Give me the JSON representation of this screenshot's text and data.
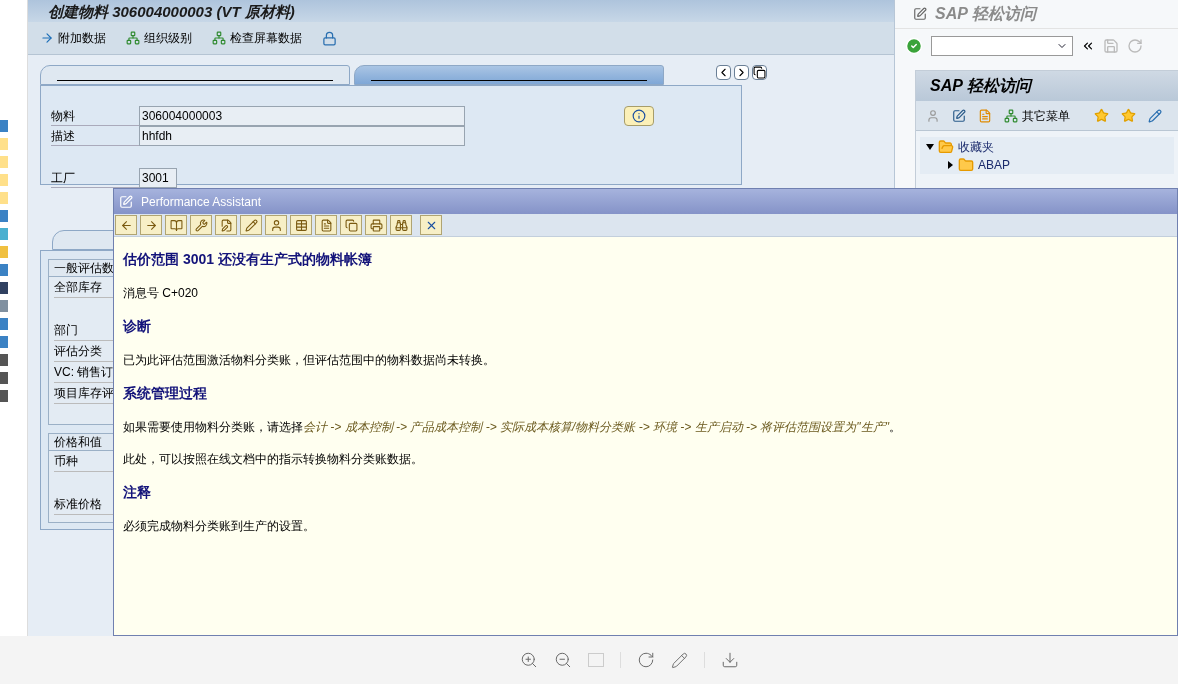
{
  "title": "创建物料 306004000003 (VT 原材料)",
  "toolbar": [
    "附加数据",
    "组织级别",
    "检查屏幕数据"
  ],
  "tabs": [
    {
      "selected": false
    },
    {
      "selected": true
    }
  ],
  "fields": [
    {
      "label": "物料",
      "value": "306004000003"
    },
    {
      "label": "描述",
      "value": "hhfdh"
    },
    {
      "label": "工厂",
      "value": "3001"
    }
  ],
  "groups": [
    {
      "title": "一般评估数",
      "rows": [
        {
          "label": "全部库存",
          "kind": "row"
        },
        {
          "label": "部门",
          "kind": "spaced"
        },
        {
          "label": "评估分类",
          "kind": "row"
        },
        {
          "label": "VC: 销售订",
          "kind": "row"
        },
        {
          "label": "项目库存评",
          "kind": "row"
        }
      ]
    },
    {
      "title": "价格和值",
      "rows": [
        {
          "label": "币种",
          "kind": "row"
        },
        {
          "label": "标准价格",
          "kind": "spaced"
        }
      ]
    }
  ],
  "easy_access": {
    "title": "SAP 轻松访问",
    "heading": "SAP 轻松访问",
    "menu_button": "其它菜单",
    "tree": [
      {
        "label": "收藏夹",
        "expanded": true,
        "children": [
          {
            "label": "ABAP",
            "expanded": false
          }
        ]
      }
    ]
  },
  "popup": {
    "title": "Performance Assistant",
    "heading": "估价范围 3001 还没有生产式的物料帐簿",
    "message_no": "消息号 C+020",
    "sections": [
      {
        "heading": "诊断",
        "paragraphs": [
          "已为此评估范围激活物料分类账，但评估范围中的物料数据尚未转换。"
        ]
      },
      {
        "heading": "系统管理过程",
        "paragraphs": [
          {
            "text": "如果需要使用物料分类账，请选择",
            "menu_path": "会计 -> 成本控制 -> 产品成本控制 -> 实际成本核算/物料分类账 -> 环境 -> 生产启动 -> 将评估范围设置为\"生产\"",
            "end": "。"
          },
          "此处，可以按照在线文档中的指示转换物料分类账数据。"
        ]
      },
      {
        "heading": "注释",
        "paragraphs": [
          "必须完成物料分类账到生产的设置。"
        ]
      }
    ]
  }
}
